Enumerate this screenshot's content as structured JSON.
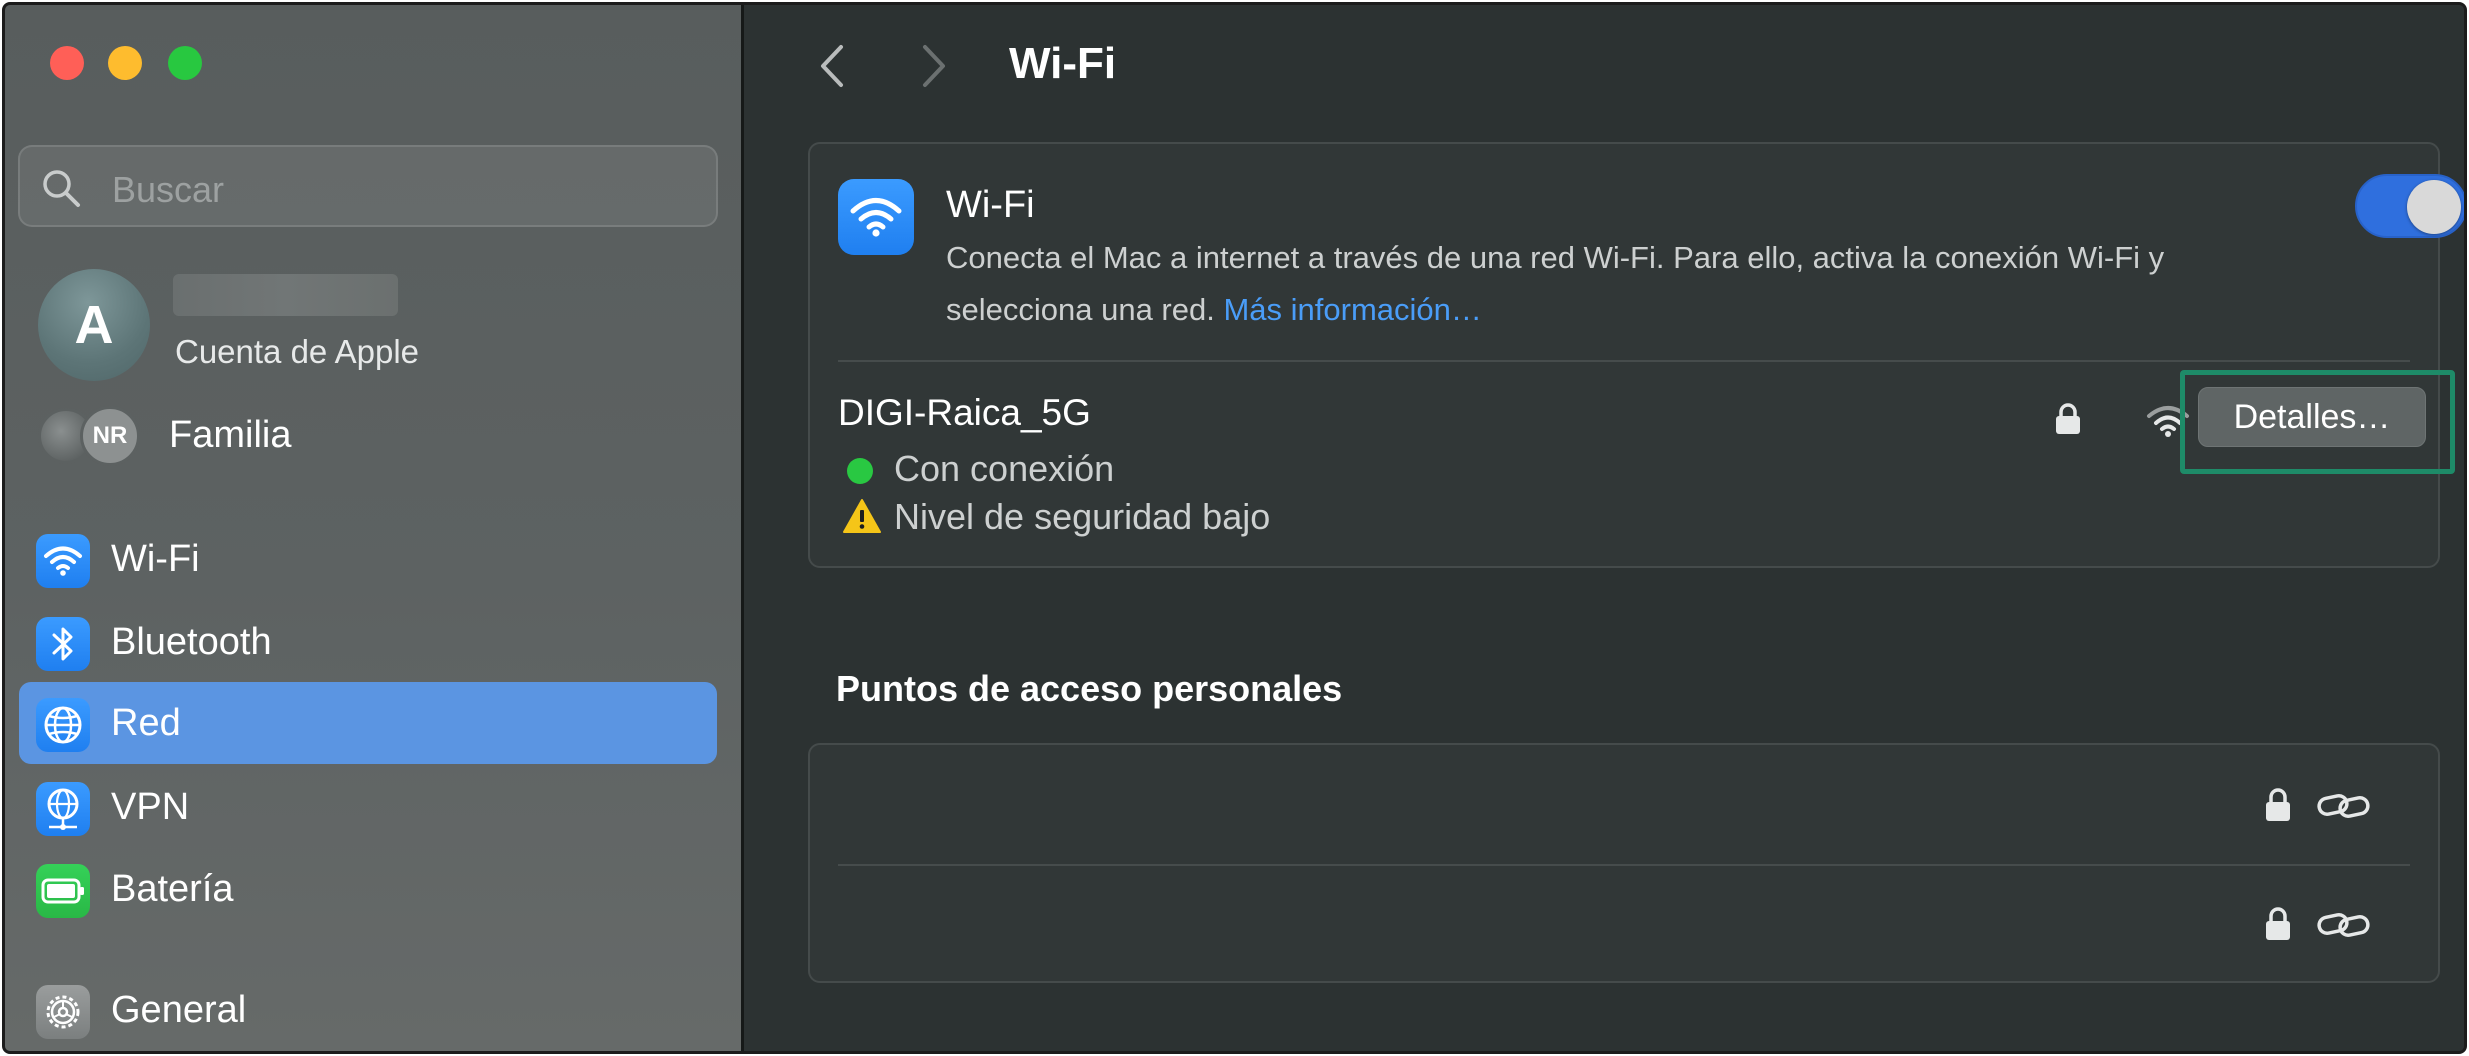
{
  "window": {
    "title": "Wi-Fi"
  },
  "sidebar": {
    "search_placeholder": "Buscar",
    "account": {
      "initial": "A",
      "subtitle": "Cuenta de Apple"
    },
    "family": {
      "badge": "NR",
      "label": "Familia"
    },
    "items": [
      {
        "label": "Wi-Fi",
        "icon": "wifi-icon",
        "selected": false
      },
      {
        "label": "Bluetooth",
        "icon": "bluetooth-icon",
        "selected": false
      },
      {
        "label": "Red",
        "icon": "globe-icon",
        "selected": true
      },
      {
        "label": "VPN",
        "icon": "vpn-globe-icon",
        "selected": false
      },
      {
        "label": "Batería",
        "icon": "battery-icon",
        "selected": false
      },
      {
        "label": "General",
        "icon": "gear-icon",
        "selected": false
      }
    ]
  },
  "main": {
    "title": "Wi-Fi",
    "wifi_card": {
      "title": "Wi-Fi",
      "description": "Conecta el Mac a internet a través de una red Wi-Fi. Para ello, activa la conexión Wi-Fi y selecciona una red.",
      "more_info_link": "Más información…",
      "toggle_on": true
    },
    "network": {
      "name": "DIGI-Raica_5G",
      "status": "Con conexión",
      "warning": "Nivel de seguridad bajo",
      "details_button": "Detalles…"
    },
    "hotspots": {
      "title": "Puntos de acceso personales",
      "rows": [
        {
          "icons": [
            "lock-icon",
            "link-icon"
          ]
        },
        {
          "icons": [
            "lock-icon",
            "link-icon"
          ]
        }
      ]
    }
  },
  "colors": {
    "accent": "#5b95e2",
    "toggle": "#2f6fde",
    "link": "#4a9df8",
    "status_green": "#29c842",
    "highlight_border": "#1e8b68"
  }
}
